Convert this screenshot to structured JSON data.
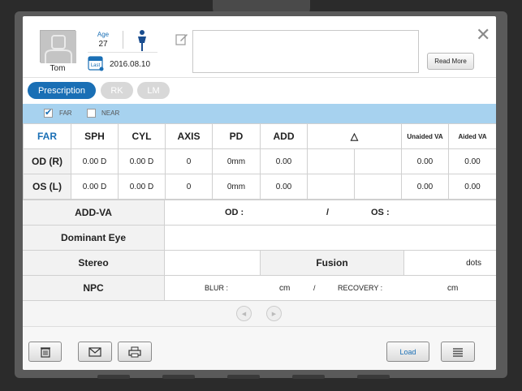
{
  "patient": {
    "name": "Tom",
    "age_label": "Age",
    "age": "27",
    "calendar_icon_text": "Last",
    "date": "2016.08.10"
  },
  "header": {
    "read_more_label": "Read  More",
    "memo_value": "",
    "close_glyph": "✕"
  },
  "tabs": [
    {
      "label": "Prescription",
      "active": true
    },
    {
      "label": "RK",
      "active": false
    },
    {
      "label": "LM",
      "active": false
    }
  ],
  "distance": {
    "far_label": "FAR",
    "far_checked": true,
    "near_label": "NEAR",
    "near_checked": false
  },
  "rx_table": {
    "headers": [
      "FAR",
      "SPH",
      "CYL",
      "AXIS",
      "PD",
      "ADD",
      "△",
      "Unaided VA",
      "Aided VA"
    ],
    "rows": [
      {
        "label": "OD (R)",
        "sph": "0.00 D",
        "cyl": "0.00 D",
        "axis": "0",
        "pd": "0mm",
        "add": "0.00",
        "prism1": "",
        "prism2": "",
        "unaided": "0.00",
        "aided": "0.00"
      },
      {
        "label": "OS (L)",
        "sph": "0.00 D",
        "cyl": "0.00 D",
        "axis": "0",
        "pd": "0mm",
        "add": "0.00",
        "prism1": "",
        "prism2": "",
        "unaided": "0.00",
        "aided": "0.00"
      }
    ]
  },
  "add_va": {
    "label": "ADD-VA",
    "od_label": "OD :",
    "slash": "/",
    "os_label": "OS :"
  },
  "dominant_eye": {
    "label": "Dominant Eye",
    "value": ""
  },
  "stereo": {
    "label": "Stereo",
    "value": "",
    "fusion_label": "Fusion",
    "fusion_unit": "dots"
  },
  "npc": {
    "label": "NPC",
    "blur_label": "BLUR :",
    "blur_unit": "cm",
    "slash": "/",
    "recovery_label": "RECOVERY :",
    "recovery_unit": "cm"
  },
  "pager": {
    "prev_glyph": "◀",
    "next_glyph": "▶"
  },
  "footer": {
    "load_label": "Load"
  },
  "colors": {
    "accent": "#1a6fb5",
    "bar": "#a7d2ef"
  },
  "icons": [
    "avatar-icon",
    "gender-icon",
    "calendar-icon",
    "edit-icon",
    "close-icon",
    "trash-icon",
    "mail-icon",
    "print-icon",
    "menu-icon"
  ]
}
